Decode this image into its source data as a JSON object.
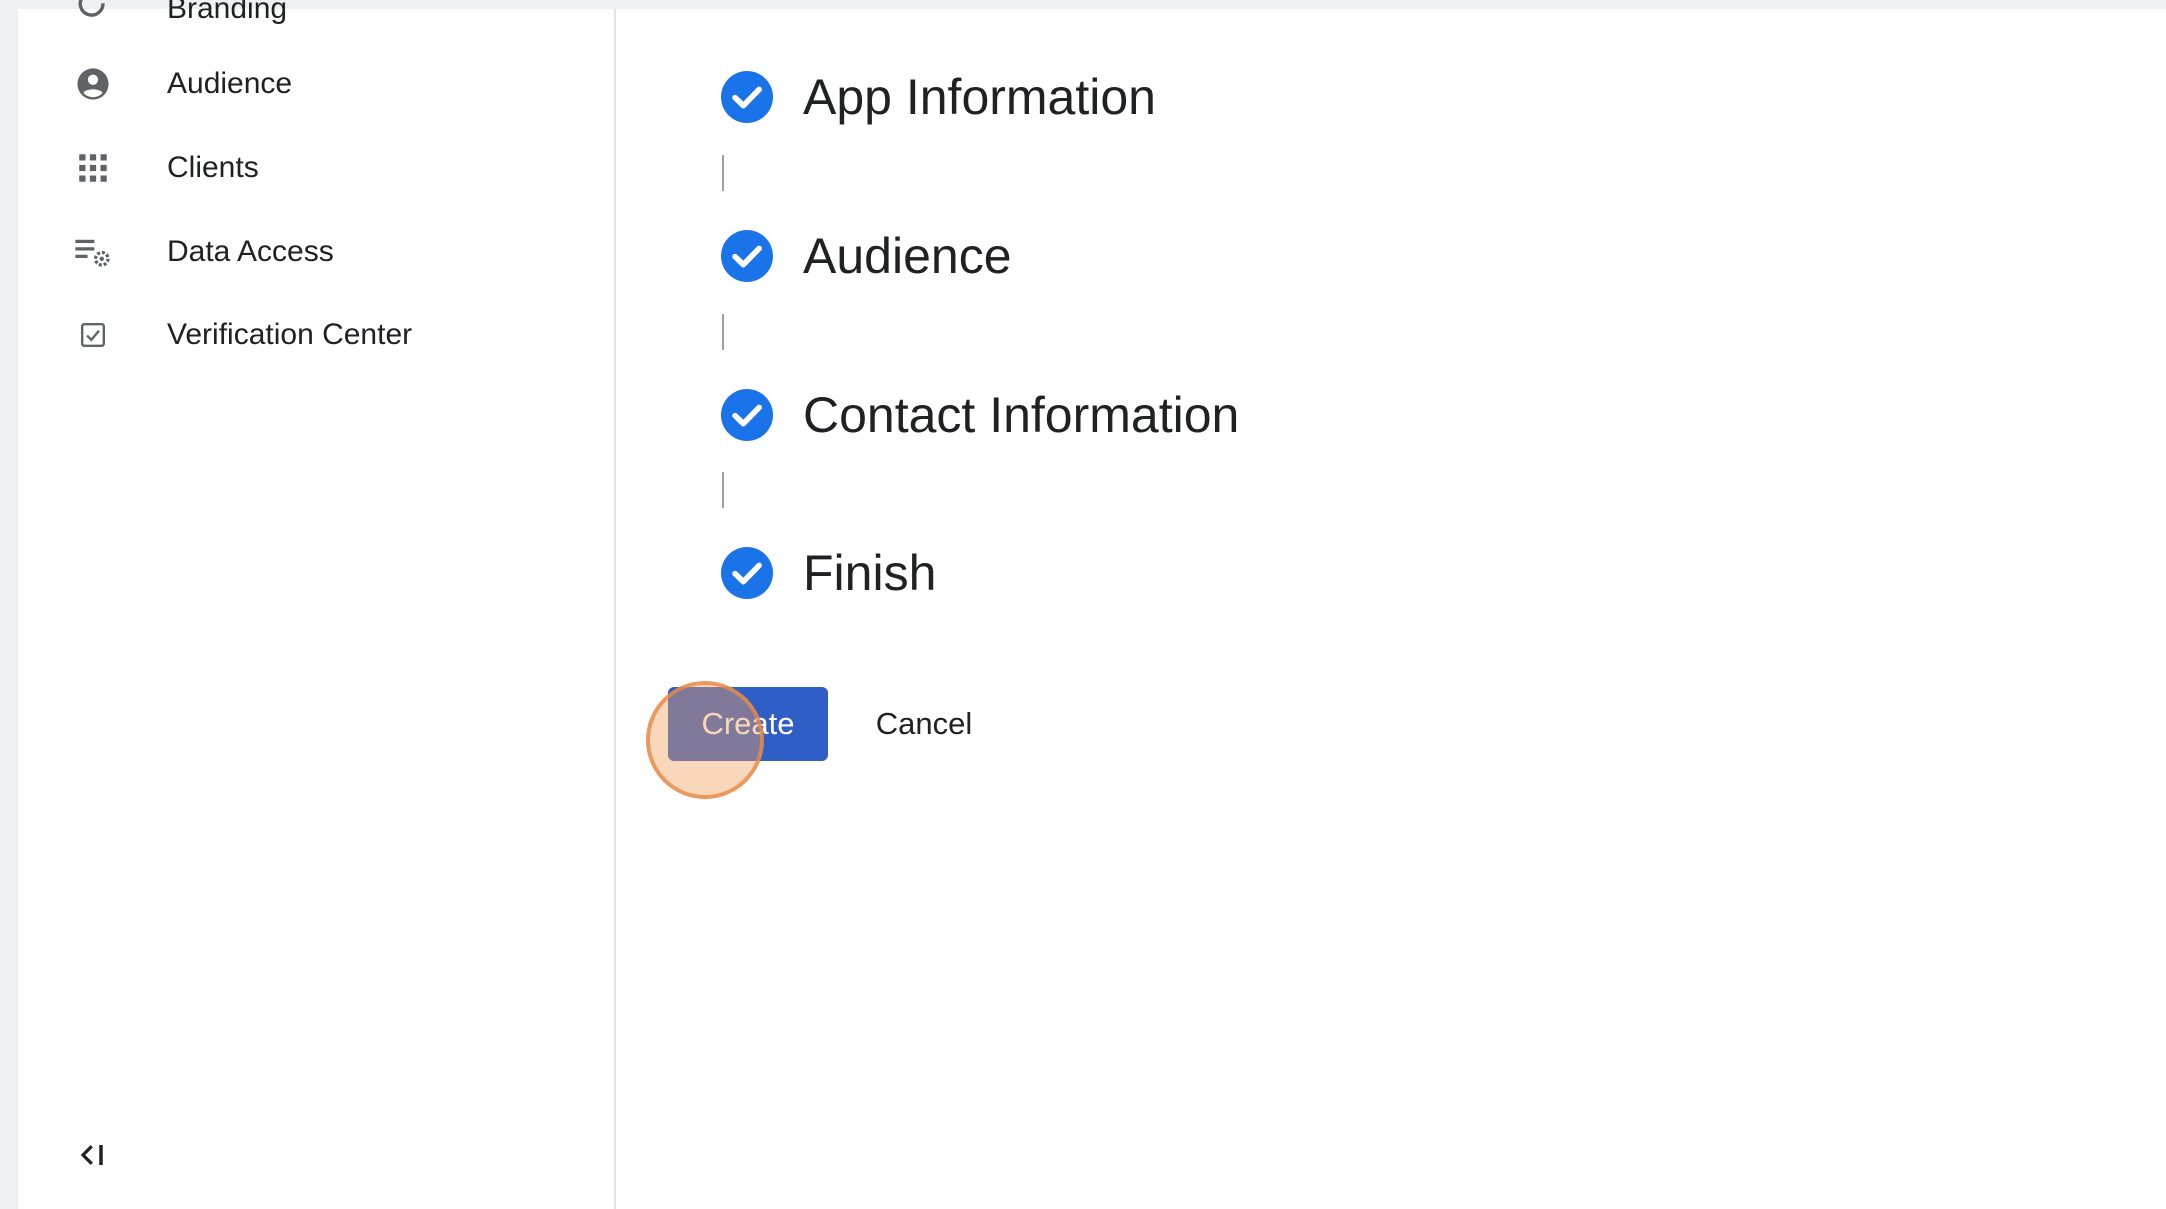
{
  "sidebar": {
    "items": [
      {
        "label": "Branding",
        "icon": "branding-icon"
      },
      {
        "label": "Audience",
        "icon": "account-circle-icon"
      },
      {
        "label": "Clients",
        "icon": "apps-grid-icon"
      },
      {
        "label": "Data Access",
        "icon": "data-settings-icon"
      },
      {
        "label": "Verification Center",
        "icon": "checkbox-icon"
      }
    ],
    "collapse_icon": "collapse-sidebar-icon"
  },
  "stepper": {
    "steps": [
      {
        "label": "App Information",
        "status": "complete"
      },
      {
        "label": "Audience",
        "status": "complete"
      },
      {
        "label": "Contact Information",
        "status": "complete"
      },
      {
        "label": "Finish",
        "status": "complete"
      }
    ]
  },
  "actions": {
    "create_label": "Create",
    "cancel_label": "Cancel"
  },
  "colors": {
    "accent": "#1a73e8",
    "create_button": "#2f5ec7",
    "click_indicator": "#f0a05a",
    "icon_gray": "#5f6368"
  }
}
